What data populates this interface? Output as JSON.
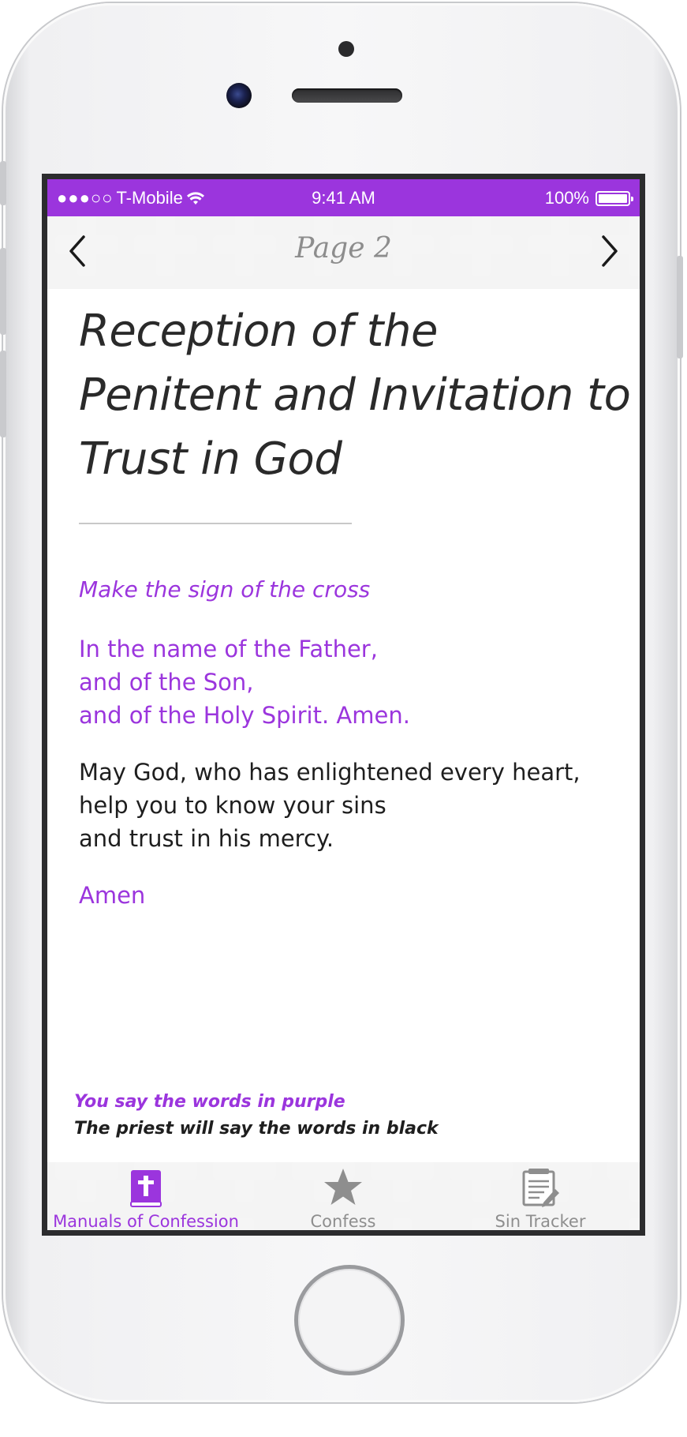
{
  "status_bar": {
    "signal": "●●●○○",
    "carrier": "T-Mobile",
    "time": "9:41 AM",
    "battery": "100%"
  },
  "nav": {
    "title": "Page 2",
    "prev_icon": "chevron-left-icon",
    "next_icon": "chevron-right-icon"
  },
  "section": {
    "title_lines": [
      "Reception of the",
      "Penitent and Invitation to",
      "Trust in God"
    ],
    "instruction": "Make the sign of the cross",
    "penitent_lines": [
      "In the name of the Father,",
      "and of the Son,",
      "and of the Holy Spirit. Amen."
    ],
    "priest_lines": [
      "May God, who has enlightened every heart,",
      "help you to know your sins",
      "and trust in his mercy."
    ],
    "response": "Amen"
  },
  "legend": {
    "purple_text": "You say the words in purple",
    "black_text": "The priest will say the words in black"
  },
  "tabs": [
    {
      "label": "Manuals of Confession",
      "icon": "bible-icon",
      "active": true
    },
    {
      "label": "Confess",
      "icon": "star-icon",
      "active": false
    },
    {
      "label": "Sin Tracker",
      "icon": "notepad-pencil-icon",
      "active": false
    }
  ],
  "colors": {
    "accent": "#9b35dd",
    "text_dark": "#1e1e1e",
    "inactive": "#8e8e8e"
  }
}
